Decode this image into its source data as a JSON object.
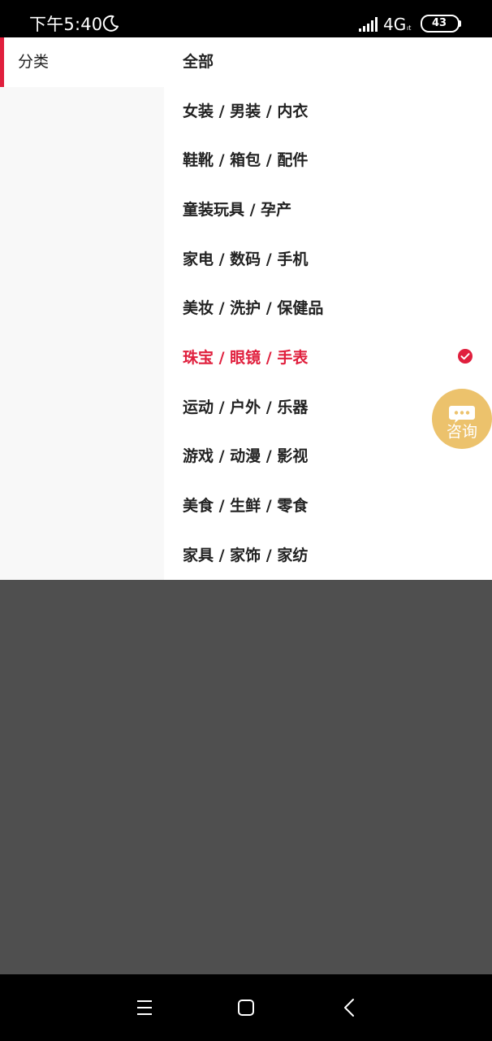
{
  "status_bar": {
    "time": "下午5:40",
    "network": "4G",
    "lte_tag": "ıt",
    "battery_level": "43"
  },
  "sidebar": {
    "active_tab": "分类",
    "accent_color": "#e01f3d"
  },
  "categories": [
    {
      "label": "全部",
      "selected": false
    },
    {
      "label": "女装 / 男装 / 内衣",
      "selected": false
    },
    {
      "label": "鞋靴 / 箱包 / 配件",
      "selected": false
    },
    {
      "label": "童装玩具 / 孕产",
      "selected": false
    },
    {
      "label": "家电 / 数码 / 手机",
      "selected": false
    },
    {
      "label": "美妆 / 洗护 / 保健品",
      "selected": false
    },
    {
      "label": "珠宝 / 眼镜 / 手表",
      "selected": true
    },
    {
      "label": "运动 / 户外 / 乐器",
      "selected": false
    },
    {
      "label": "游戏 / 动漫 / 影视",
      "selected": false
    },
    {
      "label": "美食 / 生鲜 / 零食",
      "selected": false
    },
    {
      "label": "家具 / 家饰 / 家纺",
      "selected": false
    }
  ],
  "consult_button": {
    "label": "咨询",
    "icon": "chat-bubble-icon",
    "color": "#ecc26c"
  },
  "nav_bar": {
    "buttons": [
      "menu-icon",
      "home-icon",
      "back-icon"
    ]
  }
}
